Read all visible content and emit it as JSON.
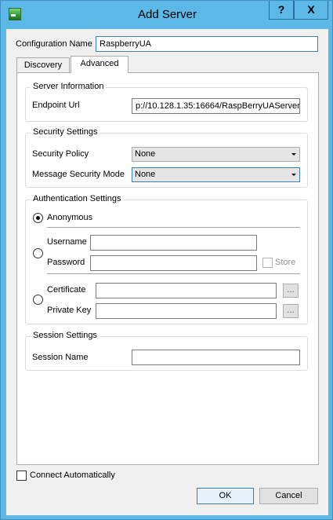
{
  "window": {
    "title": "Add Server",
    "help_glyph": "?",
    "close_glyph": "X"
  },
  "configuration": {
    "label": "Configuration Name",
    "value": "RaspberryUA"
  },
  "tabs": [
    {
      "label": "Discovery",
      "active": false
    },
    {
      "label": "Advanced",
      "active": true
    }
  ],
  "server_information": {
    "title": "Server Information",
    "endpoint_label": "Endpoint Url",
    "endpoint_value": "p://10.128.1.35:16664/RaspBerryUAServer"
  },
  "security_settings": {
    "title": "Security Settings",
    "policy_label": "Security Policy",
    "policy_value": "None",
    "mode_label": "Message Security Mode",
    "mode_value": "None"
  },
  "authentication_settings": {
    "title": "Authentication Settings",
    "anonymous_label": "Anonymous",
    "username_label": "Username",
    "username_value": "",
    "password_label": "Password",
    "password_value": "",
    "store_label": "Store",
    "certificate_label": "Certificate",
    "certificate_value": "",
    "private_key_label": "Private Key",
    "private_key_value": "",
    "browse_glyph": "..."
  },
  "session_settings": {
    "title": "Session Settings",
    "session_name_label": "Session Name",
    "session_name_value": ""
  },
  "footer": {
    "connect_auto_label": "Connect Automatically",
    "ok_label": "OK",
    "cancel_label": "Cancel"
  },
  "colors": {
    "title_bar": "#5cb8e6",
    "client_bg": "#f0f0f0",
    "focus_border": "#3c7fb1"
  }
}
